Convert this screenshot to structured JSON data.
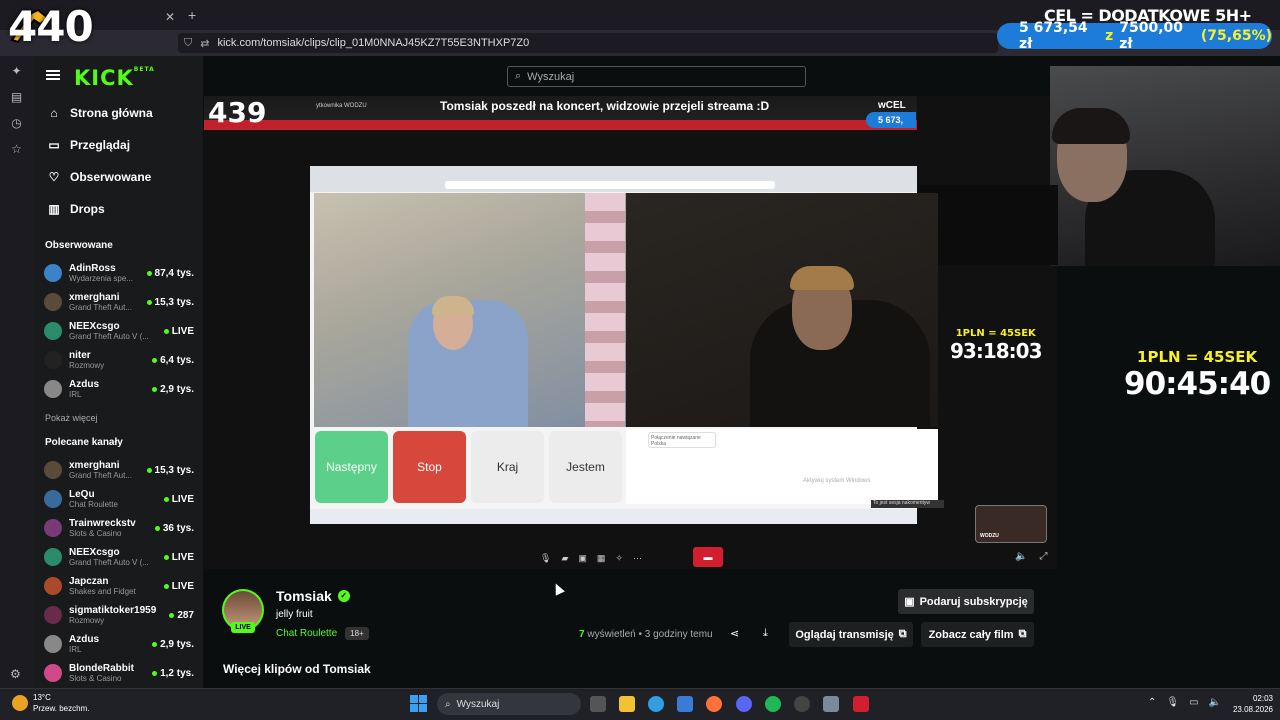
{
  "browser": {
    "url": "kick.com/tomsiak/clips/clip_01M0NNAJ45KZ7T55E3NTHXP7Z0",
    "tab_title": "Tomsiak"
  },
  "overlay": {
    "counter": "440",
    "goal_title": "CEL = DODATKOWE 5H+",
    "goal_current": "5 673,54 zł",
    "goal_sep": "z",
    "goal_target": "7500,00 zł",
    "goal_pct": "(75,65%)",
    "timer_inner_rate": "1PLN = 45SEK",
    "timer_inner": "93:18:03",
    "timer_outer_rate": "1PLN = 45SEK",
    "timer_outer": "90:45:40"
  },
  "kick": {
    "logo": "KICK",
    "logo_badge": "BETA",
    "search_placeholder": "Wyszukaj",
    "nav": [
      {
        "label": "Strona główna",
        "icon": "home-icon"
      },
      {
        "label": "Przeglądaj",
        "icon": "browse-icon"
      },
      {
        "label": "Obserwowane",
        "icon": "heart-icon"
      },
      {
        "label": "Drops",
        "icon": "drops-icon"
      }
    ],
    "followed_header": "Obserwowane",
    "followed": [
      {
        "name": "AdinRoss",
        "sub": "Wydarzenia spe...",
        "viewers": "87,4 tys.",
        "color": "#3c82c8"
      },
      {
        "name": "xmerghani",
        "sub": "Grand Theft Aut...",
        "viewers": "15,3 tys.",
        "color": "#5a4a3a"
      },
      {
        "name": "NEEXcsgo",
        "sub": "Grand Theft Auto V (...",
        "viewers": "LIVE",
        "color": "#2a8c6a"
      },
      {
        "name": "niter",
        "sub": "Rozmowy",
        "viewers": "6,4 tys.",
        "color": "#222222"
      },
      {
        "name": "Azdus",
        "sub": "IRL",
        "viewers": "2,9 tys.",
        "color": "#888888"
      }
    ],
    "show_more": "Pokaż więcej",
    "recommended_header": "Polecane kanały",
    "recommended": [
      {
        "name": "xmerghani",
        "sub": "Grand Theft Aut...",
        "viewers": "15,3 tys.",
        "color": "#5a4a3a"
      },
      {
        "name": "LeQu",
        "sub": "Chat Roulette",
        "viewers": "LIVE",
        "color": "#3a6a9a"
      },
      {
        "name": "Trainwreckstv",
        "sub": "Slots & Casino",
        "viewers": "36 tys.",
        "color": "#7a3a7a"
      },
      {
        "name": "NEEXcsgo",
        "sub": "Grand Theft Auto V (...",
        "viewers": "LIVE",
        "color": "#2a8c6a"
      },
      {
        "name": "Japczan",
        "sub": "Shakes and Fidget",
        "viewers": "LIVE",
        "color": "#aa4a2a"
      },
      {
        "name": "sigmatiktoker1959",
        "sub": "Rozmowy",
        "viewers": "287",
        "color": "#6a2a4a"
      },
      {
        "name": "Azdus",
        "sub": "IRL",
        "viewers": "2,9 tys.",
        "color": "#888888"
      },
      {
        "name": "BlondeRabbit",
        "sub": "Slots & Casino",
        "viewers": "1,2 tys.",
        "color": "#d04a8a"
      }
    ]
  },
  "video": {
    "banner_counter": "439",
    "banner_title": "Tomsiak poszedł na koncert, widzowie przejeli streama :D",
    "banner_small": "ytkownika WODZU",
    "banner_goal": "5 673,",
    "banner_goal_title": "wCEL",
    "ome_next": "Następny",
    "ome_stop": "Stop",
    "ome_country": "Kraj",
    "ome_iam": "Jestem",
    "ome_chat_msg": "Połączenie nawiązane Polska",
    "windows_activate": "Aktywuj system Windows",
    "tooltip": "To jest sesja nakomentyw",
    "small_cam_label": "WODZU"
  },
  "clip": {
    "streamer": "Tomsiak",
    "live_badge": "LIVE",
    "title": "jelly fruit",
    "category": "Chat Roulette",
    "age": "18+",
    "views_count": "7",
    "views_label": "wyświetleń",
    "time_ago": "3 godziny temu",
    "gift_sub": "Podaruj subskrypcję",
    "watch_stream": "Oglądaj transmisję",
    "full_video": "Zobacz cały film",
    "more_clips": "Więcej klipów od Tomsiak"
  },
  "taskbar": {
    "temp": "13°C",
    "weather": "Przew. bezchm.",
    "search_placeholder": "Wyszukaj",
    "time": "02:03",
    "date": "23.08.2026"
  }
}
